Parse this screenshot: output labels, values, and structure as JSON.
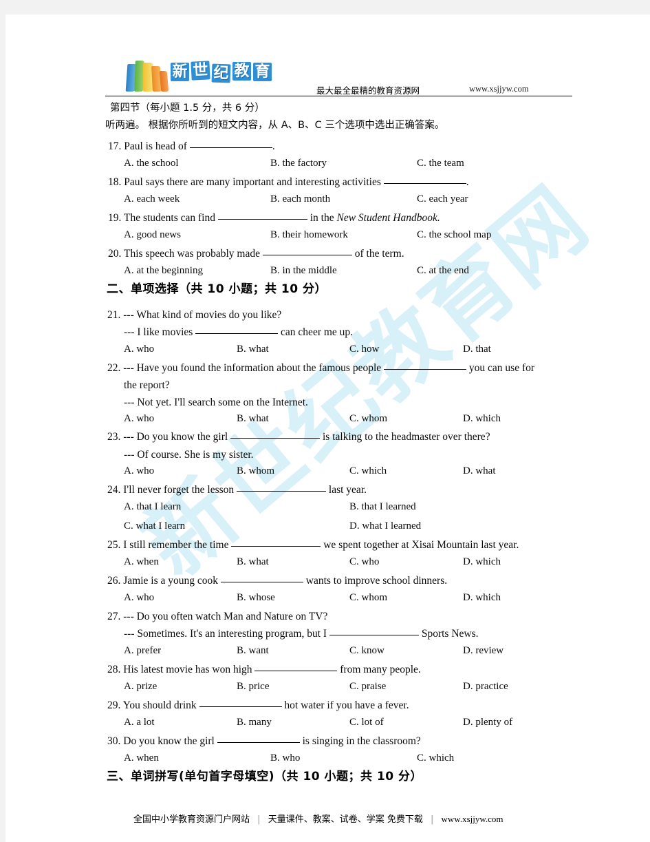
{
  "header": {
    "logo_books_alt": "stack-of-books",
    "logo_chars": [
      "新",
      "世",
      "纪",
      "教",
      "育"
    ],
    "tagline": "最大最全最精的教育资源网",
    "url": "www.xsjjyw.com"
  },
  "watermark": {
    "text": "新世纪教育网",
    "color": "#d8f0f7"
  },
  "section_four": {
    "heading": "第四节（每小题 1.5 分，共 6 分）",
    "instruction": "听两遍。 根据你所听到的短文内容，从 A、B、C 三个选项中选出正确答案。",
    "questions": [
      {
        "number": "17.",
        "stem_pre": "Paul is head of",
        "stem_post": ".",
        "options": [
          "A. the school",
          "B. the factory",
          "C. the team"
        ]
      },
      {
        "number": "18.",
        "stem_pre": "Paul says there are many important and interesting activities",
        "stem_post": ".",
        "options": [
          "A. each week",
          "B. each month",
          "C. each year"
        ]
      },
      {
        "number": "19.",
        "stem_pre": "The students can find",
        "stem_mid": "in the",
        "stem_italic": "New Student Handbook.",
        "options": [
          "A. good news",
          "B. their homework",
          "C. the school map"
        ]
      },
      {
        "number": "20.",
        "stem_pre": "This speech was probably made",
        "stem_post": "of the term.",
        "options": [
          "A. at the beginning",
          "B. in the middle",
          "C. at the end"
        ]
      }
    ]
  },
  "section_two": {
    "heading": "二、单项选择（共 10 小题；共 10 分）",
    "questions": [
      {
        "number": "21.",
        "line1": "--- What kind of movies do you like?",
        "line2_pre": "--- I like movies",
        "line2_post": "can cheer me up.",
        "options": [
          "A. who",
          "B. what",
          "C. how",
          "D. that"
        ]
      },
      {
        "number": "22.",
        "line1_pre": "--- Have you found the information about the famous people",
        "line1_post": "you can use for",
        "line2": "the report?",
        "line3": "--- Not yet. I'll search some on the Internet.",
        "options": [
          "A. who",
          "B. what",
          "C. whom",
          "D. which"
        ]
      },
      {
        "number": "23.",
        "line1_pre": "--- Do you know the girl",
        "line1_post": "is talking to the headmaster over there?",
        "line2": "--- Of course. She is my sister.",
        "options": [
          "A. who",
          "B. whom",
          "C. which",
          "D. what"
        ]
      },
      {
        "number": "24.",
        "line1_pre": "I'll never forget the lesson",
        "line1_post": "last year.",
        "options_2col": [
          "A. that I learn",
          "B. that I learned",
          "C. what I learn",
          "D. what I learned"
        ]
      },
      {
        "number": "25.",
        "line1_pre": "I still remember the time",
        "line1_post": "we spent together at Xisai Mountain last year.",
        "options": [
          "A. when",
          "B. what",
          "C. who",
          "D. which"
        ]
      },
      {
        "number": "26.",
        "line1_pre": "Jamie is a young cook",
        "line1_post": "wants to improve school dinners.",
        "options": [
          "A. who",
          "B. whose",
          "C. whom",
          "D. which"
        ]
      },
      {
        "number": "27.",
        "line1": "--- Do you often watch Man and Nature on TV?",
        "line2_pre": "--- Sometimes. It's an interesting program, but I",
        "line2_post": "Sports News.",
        "options": [
          "A. prefer",
          "B. want",
          "C. know",
          "D. review"
        ]
      },
      {
        "number": "28.",
        "line1_pre": "His latest movie has won high",
        "line1_post": "from many people.",
        "options": [
          "A. prize",
          "B. price",
          "C. praise",
          "D. practice"
        ]
      },
      {
        "number": "29.",
        "line1_pre": "You should drink",
        "line1_post": "hot water if you have a fever.",
        "options": [
          "A. a lot",
          "B. many",
          "C. lot of",
          "D. plenty of"
        ]
      },
      {
        "number": "30.",
        "line1_pre": "Do you know the girl",
        "line1_post": "is singing in the classroom?",
        "options": [
          "A. when",
          "B. who",
          "C. which"
        ]
      }
    ]
  },
  "section_three": {
    "heading": "三、单词拼写(单句首字母填空)（共 10 小题；共 10 分）"
  },
  "footer": {
    "left": "全国中小学教育资源门户网站",
    "middle": "天量课件、教案、试卷、学案 免费下载",
    "url": "www.xsjjyw.com",
    "sep": "|"
  }
}
